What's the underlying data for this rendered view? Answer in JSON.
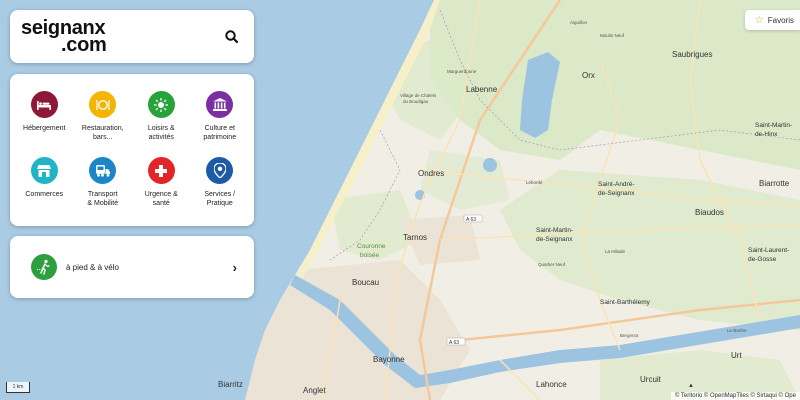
{
  "logo": {
    "line1": "seignanx",
    "line2": ".com"
  },
  "search": {
    "icon": "search-icon"
  },
  "categories": [
    {
      "label": "Hébergement",
      "icon": "bed-icon",
      "color": "#8f1836",
      "glyph": "🛏"
    },
    {
      "label": "Restauration,\nbars...",
      "icon": "dining-icon",
      "color": "#f4b400",
      "glyph": "🍴"
    },
    {
      "label": "Loisirs &\nactivités",
      "icon": "sun-icon",
      "color": "#27a33b",
      "glyph": "✺"
    },
    {
      "label": "Culture et\npatrimoine",
      "icon": "museum-icon",
      "color": "#7b2fa3",
      "glyph": "🏛"
    },
    {
      "label": "Commerces",
      "icon": "shop-icon",
      "color": "#1fb4c6",
      "glyph": "▭"
    },
    {
      "label": "Transport\n& Mobilité",
      "icon": "bus-icon",
      "color": "#1c86c9",
      "glyph": "🚌"
    },
    {
      "label": "Urgence &\nsanté",
      "icon": "medical-cross-icon",
      "color": "#e32428",
      "glyph": "✚"
    },
    {
      "label": "Services /\nPratique",
      "icon": "map-pin-icon",
      "color": "#1f5aa6",
      "glyph": "⦿"
    }
  ],
  "walk": {
    "label": "à pied & à vélo",
    "icon": "hiking-icon",
    "color": "#2e9e3e"
  },
  "favorites": {
    "label": "Favoris"
  },
  "scale": "1 km",
  "attribution": "© Teritorio © OpenMapTiles © Sirtaqui © Ope",
  "map": {
    "towns_large": [
      "Labenne",
      "Orx",
      "Ondres",
      "Tarnos",
      "Boucau",
      "Bayonne",
      "Anglet",
      "Biarritz",
      "Lahonce",
      "Urcuit",
      "Urt",
      "Biaudos",
      "Biarrotte",
      "Saubrigues"
    ],
    "towns_medium": [
      "Saint-André-\nde-Seignanx",
      "Saint-Martin-\nde-Seignanx",
      "Saint-Barthélemy",
      "Saint-Laurent-\nde-Gosse",
      "Saint-Martin-\nde-Hinx"
    ],
    "feature": "Couronne\nboisée",
    "roads": [
      "A 63",
      "A 63"
    ],
    "small_places": [
      "Village de Chalets\ndu Boudigau",
      "Marguerdonne",
      "Lebordé",
      "Quartier Neuf",
      "La Hillade",
      "Aiguillon",
      "Moulin Neuf",
      "Bergenot",
      "Le Barthe"
    ]
  }
}
